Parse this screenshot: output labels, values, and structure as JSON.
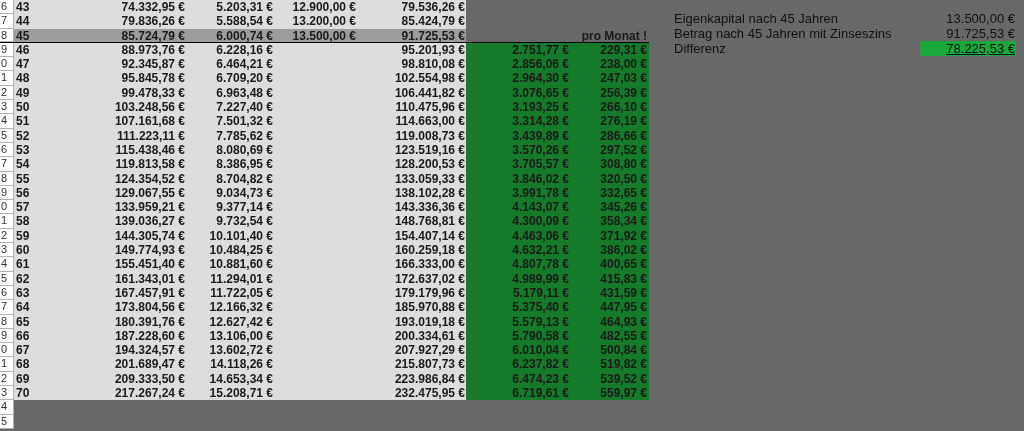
{
  "rows": [
    {
      "row_header": "6",
      "highlighted": false,
      "column_1": "43",
      "column_2": "74.332,95 €",
      "column_3": "5.203,31 €",
      "column_4": "12.900,00 €",
      "column_5": "79.536,26 €"
    },
    {
      "row_header": "7",
      "highlighted": false,
      "column_1": "44",
      "column_2": "79.836,26 €",
      "column_3": "5.588,54 €",
      "column_4": "13.200,00 €",
      "column_5": "85.424,79 €"
    },
    {
      "row_header": "8",
      "highlighted": true,
      "column_1": "45",
      "column_2": "85.724,79 €",
      "column_3": "6.000,74 €",
      "column_4": "13.500,00 €",
      "column_5": "91.725,53 €",
      "column_7": "pro Monat !"
    },
    {
      "row_header": "9",
      "highlighted": false,
      "column_1": "46",
      "column_2": "88.973,76 €",
      "column_3": "6.228,16 €",
      "column_5": "95.201,93 €",
      "column_6": "2.751,77 €",
      "column_7": "229,31 €"
    },
    {
      "row_header": "0",
      "highlighted": false,
      "column_1": "47",
      "column_2": "92.345,87 €",
      "column_3": "6.464,21 €",
      "column_5": "98.810,08 €",
      "column_6": "2.856,06 €",
      "column_7": "238,00 €"
    },
    {
      "row_header": "1",
      "highlighted": false,
      "column_1": "48",
      "column_2": "95.845,78 €",
      "column_3": "6.709,20 €",
      "column_5": "102.554,98 €",
      "column_6": "2.964,30 €",
      "column_7": "247,03 €"
    },
    {
      "row_header": "2",
      "highlighted": false,
      "column_1": "49",
      "column_2": "99.478,33 €",
      "column_3": "6.963,48 €",
      "column_5": "106.441,82 €",
      "column_6": "3.076,65 €",
      "column_7": "256,39 €"
    },
    {
      "row_header": "3",
      "highlighted": false,
      "column_1": "50",
      "column_2": "103.248,56 €",
      "column_3": "7.227,40 €",
      "column_5": "110.475,96 €",
      "column_6": "3.193,25 €",
      "column_7": "266,10 €"
    },
    {
      "row_header": "4",
      "highlighted": false,
      "column_1": "51",
      "column_2": "107.161,68 €",
      "column_3": "7.501,32 €",
      "column_5": "114.663,00 €",
      "column_6": "3.314,28 €",
      "column_7": "276,19 €"
    },
    {
      "row_header": "5",
      "highlighted": false,
      "column_1": "52",
      "column_2": "111.223,11 €",
      "column_3": "7.785,62 €",
      "column_5": "119.008,73 €",
      "column_6": "3.439,89 €",
      "column_7": "286,66 €"
    },
    {
      "row_header": "6",
      "highlighted": false,
      "column_1": "53",
      "column_2": "115.438,46 €",
      "column_3": "8.080,69 €",
      "column_5": "123.519,16 €",
      "column_6": "3.570,26 €",
      "column_7": "297,52 €"
    },
    {
      "row_header": "7",
      "highlighted": false,
      "column_1": "54",
      "column_2": "119.813,58 €",
      "column_3": "8.386,95 €",
      "column_5": "128.200,53 €",
      "column_6": "3.705,57 €",
      "column_7": "308,80 €"
    },
    {
      "row_header": "8",
      "highlighted": false,
      "column_1": "55",
      "column_2": "124.354,52 €",
      "column_3": "8.704,82 €",
      "column_5": "133.059,33 €",
      "column_6": "3.846,02 €",
      "column_7": "320,50 €"
    },
    {
      "row_header": "9",
      "highlighted": false,
      "column_1": "56",
      "column_2": "129.067,55 €",
      "column_3": "9.034,73 €",
      "column_5": "138.102,28 €",
      "column_6": "3.991,78 €",
      "column_7": "332,65 €"
    },
    {
      "row_header": "0",
      "highlighted": false,
      "column_1": "57",
      "column_2": "133.959,21 €",
      "column_3": "9.377,14 €",
      "column_5": "143.336,36 €",
      "column_6": "4.143,07 €",
      "column_7": "345,26 €"
    },
    {
      "row_header": "1",
      "highlighted": false,
      "column_1": "58",
      "column_2": "139.036,27 €",
      "column_3": "9.732,54 €",
      "column_5": "148.768,81 €",
      "column_6": "4.300,09 €",
      "column_7": "358,34 €"
    },
    {
      "row_header": "2",
      "highlighted": false,
      "column_1": "59",
      "column_2": "144.305,74 €",
      "column_3": "10.101,40 €",
      "column_5": "154.407,14 €",
      "column_6": "4.463,06 €",
      "column_7": "371,92 €"
    },
    {
      "row_header": "3",
      "highlighted": false,
      "column_1": "60",
      "column_2": "149.774,93 €",
      "column_3": "10.484,25 €",
      "column_5": "160.259,18 €",
      "column_6": "4.632,21 €",
      "column_7": "386,02 €"
    },
    {
      "row_header": "4",
      "highlighted": false,
      "column_1": "61",
      "column_2": "155.451,40 €",
      "column_3": "10.881,60 €",
      "column_5": "166.333,00 €",
      "column_6": "4.807,78 €",
      "column_7": "400,65 €"
    },
    {
      "row_header": "5",
      "highlighted": false,
      "column_1": "62",
      "column_2": "161.343,01 €",
      "column_3": "11.294,01 €",
      "column_5": "172.637,02 €",
      "column_6": "4.989,99 €",
      "column_7": "415,83 €"
    },
    {
      "row_header": "6",
      "highlighted": false,
      "column_1": "63",
      "column_2": "167.457,91 €",
      "column_3": "11.722,05 €",
      "column_5": "179.179,96 €",
      "column_6": "5.179,11 €",
      "column_7": "431,59 €"
    },
    {
      "row_header": "7",
      "highlighted": false,
      "column_1": "64",
      "column_2": "173.804,56 €",
      "column_3": "12.166,32 €",
      "column_5": "185.970,88 €",
      "column_6": "5.375,40 €",
      "column_7": "447,95 €"
    },
    {
      "row_header": "8",
      "highlighted": false,
      "column_1": "65",
      "column_2": "180.391,76 €",
      "column_3": "12.627,42 €",
      "column_5": "193.019,18 €",
      "column_6": "5.579,13 €",
      "column_7": "464,93 €"
    },
    {
      "row_header": "9",
      "highlighted": false,
      "column_1": "66",
      "column_2": "187.228,60 €",
      "column_3": "13.106,00 €",
      "column_5": "200.334,61 €",
      "column_6": "5.790,58 €",
      "column_7": "482,55 €"
    },
    {
      "row_header": "0",
      "highlighted": false,
      "column_1": "67",
      "column_2": "194.324,57 €",
      "column_3": "13.602,72 €",
      "column_5": "207.927,29 €",
      "column_6": "6.010,04 €",
      "column_7": "500,84 €"
    },
    {
      "row_header": "1",
      "highlighted": false,
      "column_1": "68",
      "column_2": "201.689,47 €",
      "column_3": "14.118,26 €",
      "column_5": "215.807,73 €",
      "column_6": "6.237,82 €",
      "column_7": "519,82 €"
    },
    {
      "row_header": "2",
      "highlighted": false,
      "column_1": "69",
      "column_2": "209.333,50 €",
      "column_3": "14.653,34 €",
      "column_5": "223.986,84 €",
      "column_6": "6.474,23 €",
      "column_7": "539,52 €"
    },
    {
      "row_header": "3",
      "highlighted": false,
      "column_1": "70",
      "column_2": "217.267,24 €",
      "column_3": "15.208,71 €",
      "column_5": "232.475,95 €",
      "column_6": "6.719,61 €",
      "column_7": "559,97 €"
    },
    {
      "row_header": "4"
    },
    {
      "row_header": "5"
    }
  ],
  "summary": [
    {
      "label": "Eigenkapital nach 45 Jahren",
      "value": "13.500,00 €",
      "highlighted": false
    },
    {
      "label": "Betrag nach 45 Jahren mit Zinseszins",
      "value": "91.725,53 €",
      "highlighted": false
    },
    {
      "label": "Differenz",
      "value": "78.225,53 €",
      "highlighted": true
    }
  ]
}
